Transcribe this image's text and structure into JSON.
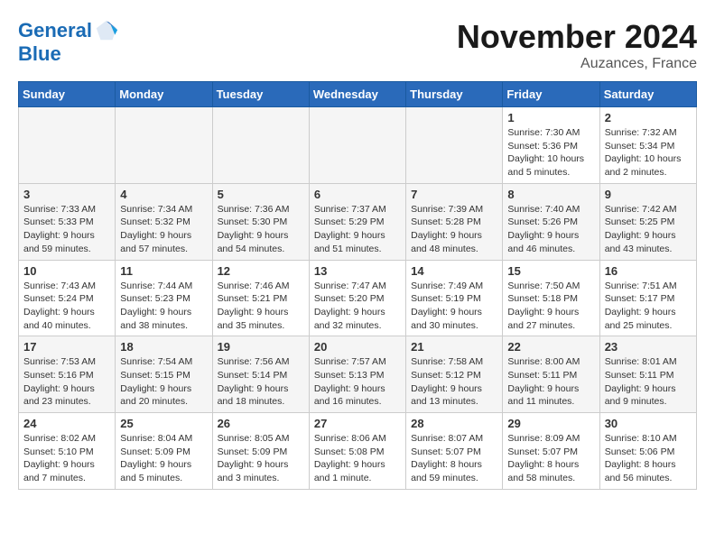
{
  "logo": {
    "line1": "General",
    "line2": "Blue"
  },
  "title": "November 2024",
  "location": "Auzances, France",
  "days_header": [
    "Sunday",
    "Monday",
    "Tuesday",
    "Wednesday",
    "Thursday",
    "Friday",
    "Saturday"
  ],
  "weeks": [
    [
      {
        "day": "",
        "info": ""
      },
      {
        "day": "",
        "info": ""
      },
      {
        "day": "",
        "info": ""
      },
      {
        "day": "",
        "info": ""
      },
      {
        "day": "",
        "info": ""
      },
      {
        "day": "1",
        "info": "Sunrise: 7:30 AM\nSunset: 5:36 PM\nDaylight: 10 hours\nand 5 minutes."
      },
      {
        "day": "2",
        "info": "Sunrise: 7:32 AM\nSunset: 5:34 PM\nDaylight: 10 hours\nand 2 minutes."
      }
    ],
    [
      {
        "day": "3",
        "info": "Sunrise: 7:33 AM\nSunset: 5:33 PM\nDaylight: 9 hours\nand 59 minutes."
      },
      {
        "day": "4",
        "info": "Sunrise: 7:34 AM\nSunset: 5:32 PM\nDaylight: 9 hours\nand 57 minutes."
      },
      {
        "day": "5",
        "info": "Sunrise: 7:36 AM\nSunset: 5:30 PM\nDaylight: 9 hours\nand 54 minutes."
      },
      {
        "day": "6",
        "info": "Sunrise: 7:37 AM\nSunset: 5:29 PM\nDaylight: 9 hours\nand 51 minutes."
      },
      {
        "day": "7",
        "info": "Sunrise: 7:39 AM\nSunset: 5:28 PM\nDaylight: 9 hours\nand 48 minutes."
      },
      {
        "day": "8",
        "info": "Sunrise: 7:40 AM\nSunset: 5:26 PM\nDaylight: 9 hours\nand 46 minutes."
      },
      {
        "day": "9",
        "info": "Sunrise: 7:42 AM\nSunset: 5:25 PM\nDaylight: 9 hours\nand 43 minutes."
      }
    ],
    [
      {
        "day": "10",
        "info": "Sunrise: 7:43 AM\nSunset: 5:24 PM\nDaylight: 9 hours\nand 40 minutes."
      },
      {
        "day": "11",
        "info": "Sunrise: 7:44 AM\nSunset: 5:23 PM\nDaylight: 9 hours\nand 38 minutes."
      },
      {
        "day": "12",
        "info": "Sunrise: 7:46 AM\nSunset: 5:21 PM\nDaylight: 9 hours\nand 35 minutes."
      },
      {
        "day": "13",
        "info": "Sunrise: 7:47 AM\nSunset: 5:20 PM\nDaylight: 9 hours\nand 32 minutes."
      },
      {
        "day": "14",
        "info": "Sunrise: 7:49 AM\nSunset: 5:19 PM\nDaylight: 9 hours\nand 30 minutes."
      },
      {
        "day": "15",
        "info": "Sunrise: 7:50 AM\nSunset: 5:18 PM\nDaylight: 9 hours\nand 27 minutes."
      },
      {
        "day": "16",
        "info": "Sunrise: 7:51 AM\nSunset: 5:17 PM\nDaylight: 9 hours\nand 25 minutes."
      }
    ],
    [
      {
        "day": "17",
        "info": "Sunrise: 7:53 AM\nSunset: 5:16 PM\nDaylight: 9 hours\nand 23 minutes."
      },
      {
        "day": "18",
        "info": "Sunrise: 7:54 AM\nSunset: 5:15 PM\nDaylight: 9 hours\nand 20 minutes."
      },
      {
        "day": "19",
        "info": "Sunrise: 7:56 AM\nSunset: 5:14 PM\nDaylight: 9 hours\nand 18 minutes."
      },
      {
        "day": "20",
        "info": "Sunrise: 7:57 AM\nSunset: 5:13 PM\nDaylight: 9 hours\nand 16 minutes."
      },
      {
        "day": "21",
        "info": "Sunrise: 7:58 AM\nSunset: 5:12 PM\nDaylight: 9 hours\nand 13 minutes."
      },
      {
        "day": "22",
        "info": "Sunrise: 8:00 AM\nSunset: 5:11 PM\nDaylight: 9 hours\nand 11 minutes."
      },
      {
        "day": "23",
        "info": "Sunrise: 8:01 AM\nSunset: 5:11 PM\nDaylight: 9 hours\nand 9 minutes."
      }
    ],
    [
      {
        "day": "24",
        "info": "Sunrise: 8:02 AM\nSunset: 5:10 PM\nDaylight: 9 hours\nand 7 minutes."
      },
      {
        "day": "25",
        "info": "Sunrise: 8:04 AM\nSunset: 5:09 PM\nDaylight: 9 hours\nand 5 minutes."
      },
      {
        "day": "26",
        "info": "Sunrise: 8:05 AM\nSunset: 5:09 PM\nDaylight: 9 hours\nand 3 minutes."
      },
      {
        "day": "27",
        "info": "Sunrise: 8:06 AM\nSunset: 5:08 PM\nDaylight: 9 hours\nand 1 minute."
      },
      {
        "day": "28",
        "info": "Sunrise: 8:07 AM\nSunset: 5:07 PM\nDaylight: 8 hours\nand 59 minutes."
      },
      {
        "day": "29",
        "info": "Sunrise: 8:09 AM\nSunset: 5:07 PM\nDaylight: 8 hours\nand 58 minutes."
      },
      {
        "day": "30",
        "info": "Sunrise: 8:10 AM\nSunset: 5:06 PM\nDaylight: 8 hours\nand 56 minutes."
      }
    ]
  ]
}
